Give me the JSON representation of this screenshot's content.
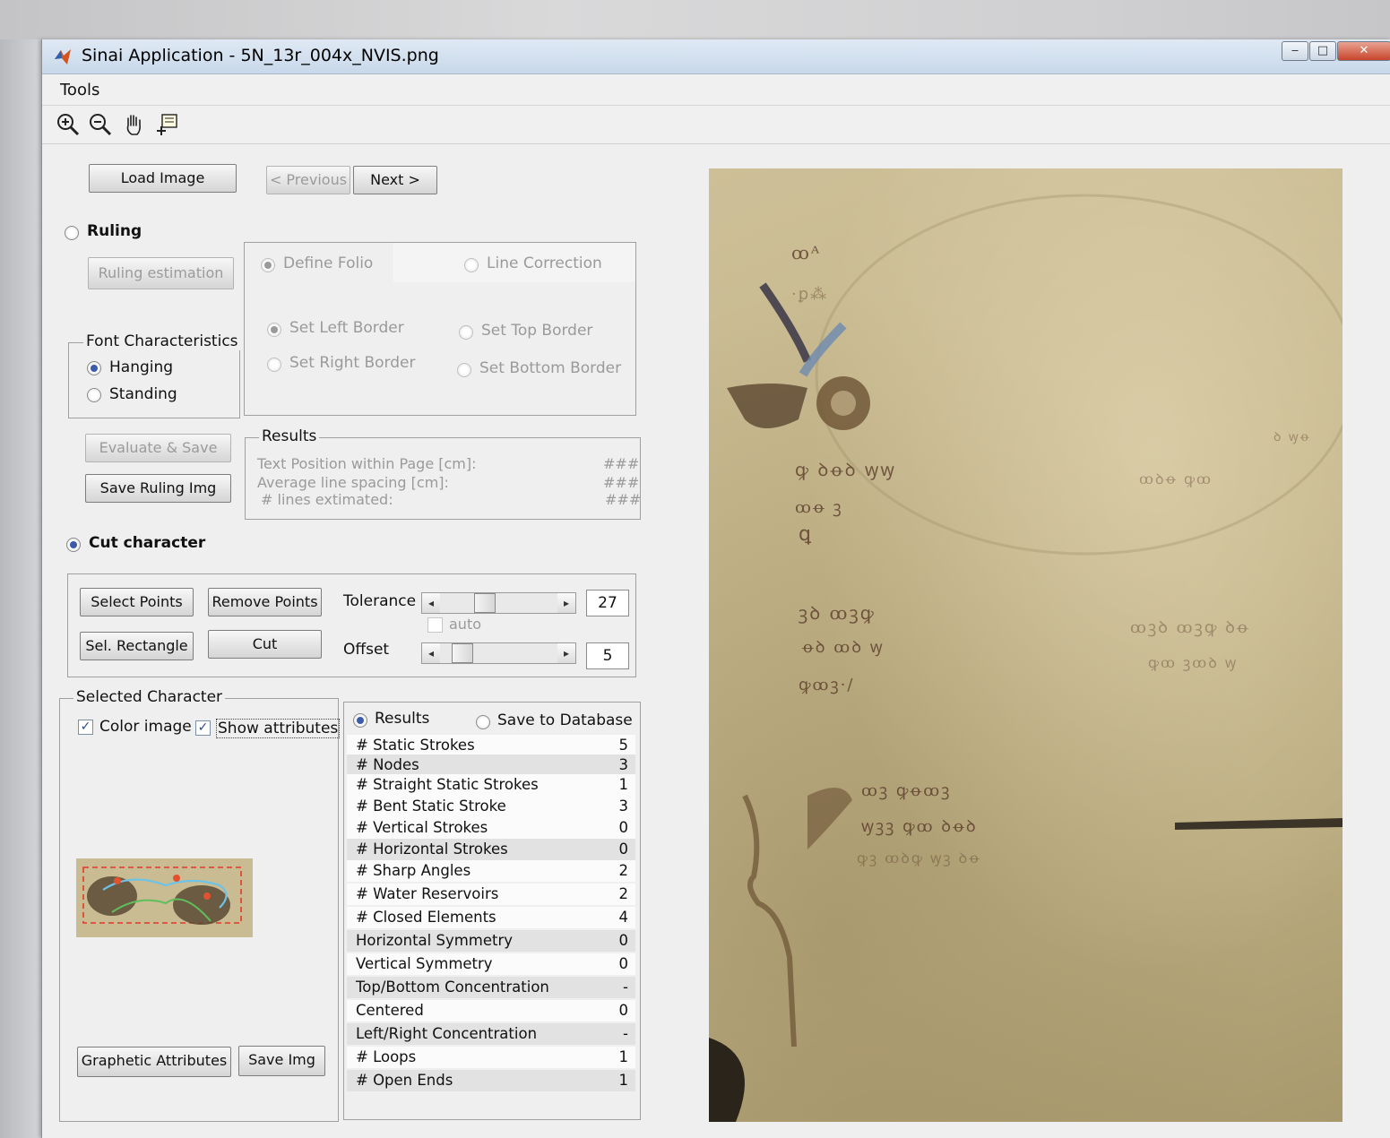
{
  "window": {
    "title": "Sinai Application - 5N_13r_004x_NVIS.png"
  },
  "menu": {
    "tools": "Tools"
  },
  "toolbar": {
    "icons": [
      "zoom-in-icon",
      "zoom-out-icon",
      "pan-hand-icon",
      "data-cursor-icon"
    ]
  },
  "nav": {
    "load_image": "Load Image",
    "previous": "< Previous",
    "next": "Next >"
  },
  "ruling": {
    "label": "Ruling",
    "selected": false,
    "estimation_button": "Ruling estimation",
    "define_folio": "Define Folio",
    "line_correction": "Line Correction",
    "set_left_border": "Set Left Border",
    "set_top_border": "Set Top Border",
    "set_right_border": "Set Right Border",
    "set_bottom_border": "Set Bottom Border",
    "font_characteristics": {
      "title": "Font Characteristics",
      "hanging": "Hanging",
      "standing": "Standing",
      "selected": "Hanging"
    },
    "evaluate_save": "Evaluate & Save",
    "save_ruling_img": "Save Ruling Img",
    "results": {
      "title": "Results",
      "rows": [
        {
          "label": "Text Position within Page [cm]:",
          "value": "###"
        },
        {
          "label": "Average line spacing [cm]:",
          "value": "###"
        },
        {
          "label": "# lines extimated:",
          "value": "###"
        }
      ]
    }
  },
  "cut": {
    "label": "Cut character",
    "selected": true,
    "select_points": "Select Points",
    "remove_points": "Remove Points",
    "sel_rectangle": "Sel. Rectangle",
    "cut_button": "Cut",
    "tolerance_label": "Tolerance",
    "tolerance_value": "27",
    "tolerance_position": 0.35,
    "auto_label": "auto",
    "offset_label": "Offset",
    "offset_value": "5",
    "offset_position": 0.12
  },
  "selected_character": {
    "title": "Selected Character",
    "color_image": "Color image",
    "show_attributes": "Show attributes",
    "color_image_checked": true,
    "show_attributes_checked": true,
    "graphetic_attributes": "Graphetic Attributes",
    "save_img": "Save Img"
  },
  "attributes": {
    "results_label": "Results",
    "save_db_label": "Save to Database",
    "rows": [
      {
        "name": "# Static Strokes",
        "value": "5"
      },
      {
        "name": "# Nodes",
        "value": "3"
      },
      {
        "name": "# Straight Static Strokes",
        "value": "1"
      },
      {
        "name": "# Bent Static Stroke",
        "value": "3"
      },
      {
        "name": "# Vertical Strokes",
        "value": "0"
      },
      {
        "name": "# Horizontal Strokes",
        "value": "0"
      },
      {
        "name": "# Sharp Angles",
        "value": "2"
      },
      {
        "name": "# Water Reservoirs",
        "value": "2"
      },
      {
        "name": "# Closed Elements",
        "value": "4"
      },
      {
        "name": "Horizontal Symmetry",
        "value": "0"
      },
      {
        "name": "Vertical Symmetry",
        "value": "0"
      },
      {
        "name": "Top/Bottom Concentration",
        "value": "-"
      },
      {
        "name": "Centered",
        "value": "0"
      },
      {
        "name": "Left/Right Concentration",
        "value": "-"
      },
      {
        "name": "# Loops",
        "value": "1"
      },
      {
        "name": "# Open Ends",
        "value": "1"
      }
    ]
  },
  "colors": {
    "accent": "#3b5cab",
    "window_bg": "#efefef",
    "title_bar": "#c8d8ea"
  }
}
